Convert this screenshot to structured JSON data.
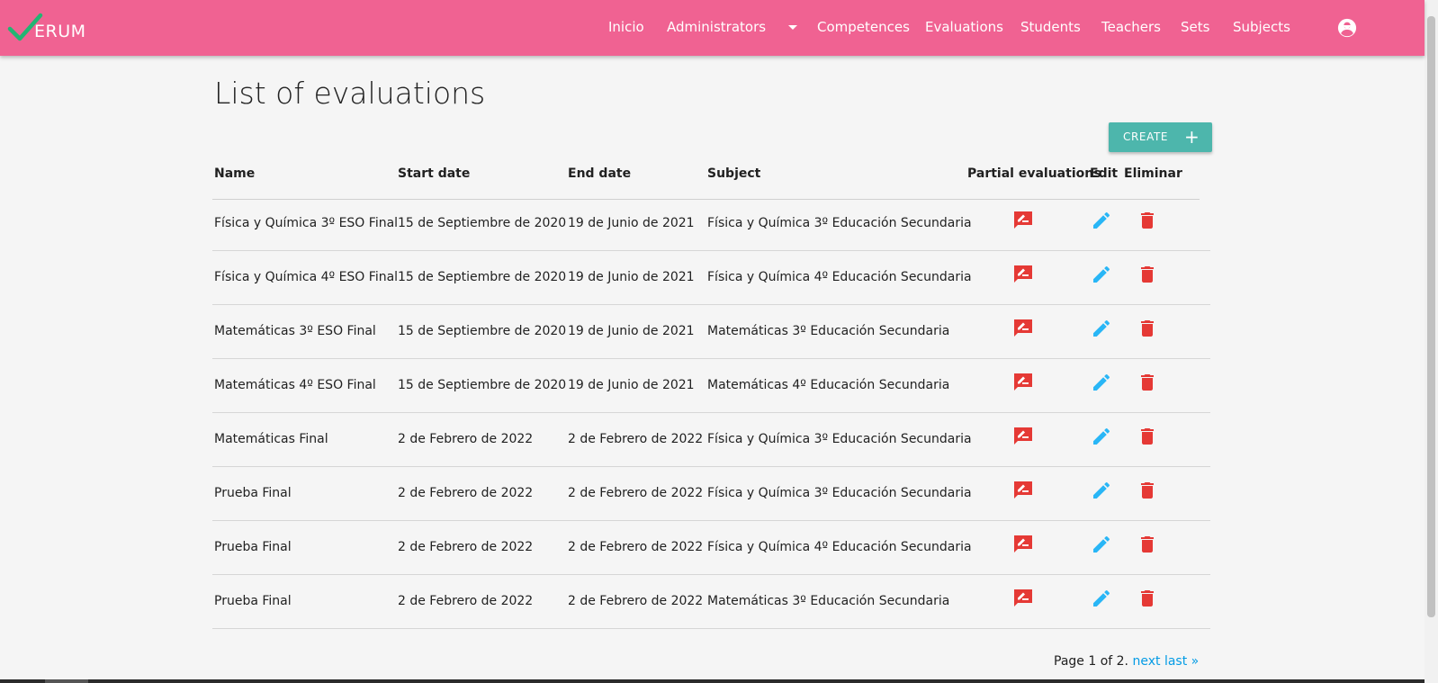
{
  "app": {
    "logo_text": "ERUM"
  },
  "nav": {
    "items": [
      "Inicio",
      "Administrators",
      "Competences",
      "Evaluations",
      "Students",
      "Teachers",
      "Sets",
      "Subjects"
    ]
  },
  "page": {
    "title": "List of evaluations",
    "create_label": "CREATE",
    "create_icon": "+"
  },
  "table": {
    "headers": [
      "Name",
      "Start date",
      "End date",
      "Subject",
      "Partial evaluations",
      "Edit",
      "Eliminar"
    ],
    "rows": [
      {
        "name": "Física y Química 3º ESO Final",
        "start": "15 de Septiembre de 2020",
        "end": "19 de Junio de 2021",
        "subject": "Física y Química 3º Educación Secundaria"
      },
      {
        "name": "Física y Química 4º ESO Final",
        "start": "15 de Septiembre de 2020",
        "end": "19 de Junio de 2021",
        "subject": "Física y Química 4º Educación Secundaria"
      },
      {
        "name": "Matemáticas 3º ESO Final",
        "start": "15 de Septiembre de 2020",
        "end": "19 de Junio de 2021",
        "subject": "Matemáticas 3º Educación Secundaria"
      },
      {
        "name": "Matemáticas 4º ESO Final",
        "start": "15 de Septiembre de 2020",
        "end": "19 de Junio de 2021",
        "subject": "Matemáticas 4º Educación Secundaria"
      },
      {
        "name": "Matemáticas Final",
        "start": "2 de Febrero de 2022",
        "end": "2 de Febrero de 2022",
        "subject": "Física y Química 3º Educación Secundaria"
      },
      {
        "name": "Prueba Final",
        "start": "2 de Febrero de 2022",
        "end": "2 de Febrero de 2022",
        "subject": "Física y Química 3º Educación Secundaria"
      },
      {
        "name": "Prueba Final",
        "start": "2 de Febrero de 2022",
        "end": "2 de Febrero de 2022",
        "subject": "Física y Química 4º Educación Secundaria"
      },
      {
        "name": "Prueba Final",
        "start": "2 de Febrero de 2022",
        "end": "2 de Febrero de 2022",
        "subject": "Matemáticas 3º Educación Secundaria"
      }
    ],
    "row_icons": {
      "partial": "rate-review-icon",
      "edit": "pencil-icon",
      "delete": "trash-icon"
    }
  },
  "pagination": {
    "text": "Page 1 of 2.",
    "next": "next",
    "last": "last »"
  },
  "colors": {
    "navbar": "#f06292",
    "create_button": "#4db6ac",
    "edit_icon": "#29b6f6",
    "delete_icon": "#e53935",
    "link": "#039be5"
  }
}
